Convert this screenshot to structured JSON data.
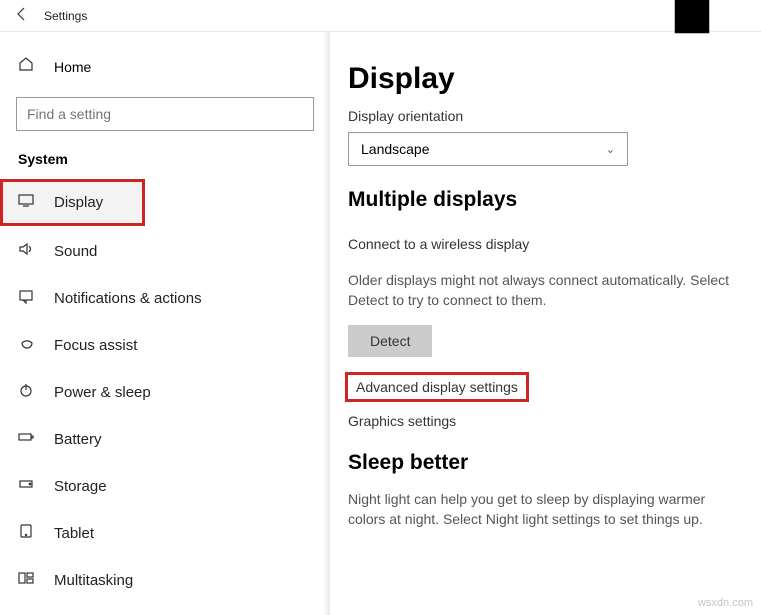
{
  "titlebar": {
    "title": "Settings"
  },
  "sidebar": {
    "home": "Home",
    "search_placeholder": "Find a setting",
    "section": "System",
    "items": [
      {
        "label": "Display"
      },
      {
        "label": "Sound"
      },
      {
        "label": "Notifications & actions"
      },
      {
        "label": "Focus assist"
      },
      {
        "label": "Power & sleep"
      },
      {
        "label": "Battery"
      },
      {
        "label": "Storage"
      },
      {
        "label": "Tablet"
      },
      {
        "label": "Multitasking"
      }
    ]
  },
  "content": {
    "page_title": "Display",
    "orientation_label": "Display orientation",
    "orientation_value": "Landscape",
    "multi_header": "Multiple displays",
    "connect_link": "Connect to a wireless display",
    "detect_desc": "Older displays might not always connect automatically. Select Detect to try to connect to them.",
    "detect_btn": "Detect",
    "advanced_link": "Advanced display settings",
    "graphics_link": "Graphics settings",
    "sleep_header": "Sleep better",
    "sleep_desc": "Night light can help you get to sleep by displaying warmer colors at night. Select Night light settings to set things up."
  },
  "watermark": "wsxdn.com"
}
